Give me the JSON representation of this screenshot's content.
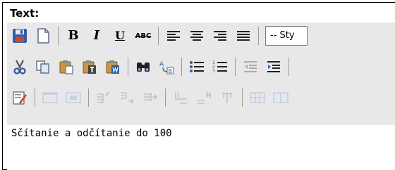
{
  "field_label": "Text:",
  "toolbar": {
    "bold_label": "B",
    "italic_label": "I",
    "underline_label": "U",
    "strike_label": "ABC",
    "style_select_value": "-- Sty"
  },
  "editor": {
    "content": "Sčítanie a odčítanie do 100"
  }
}
